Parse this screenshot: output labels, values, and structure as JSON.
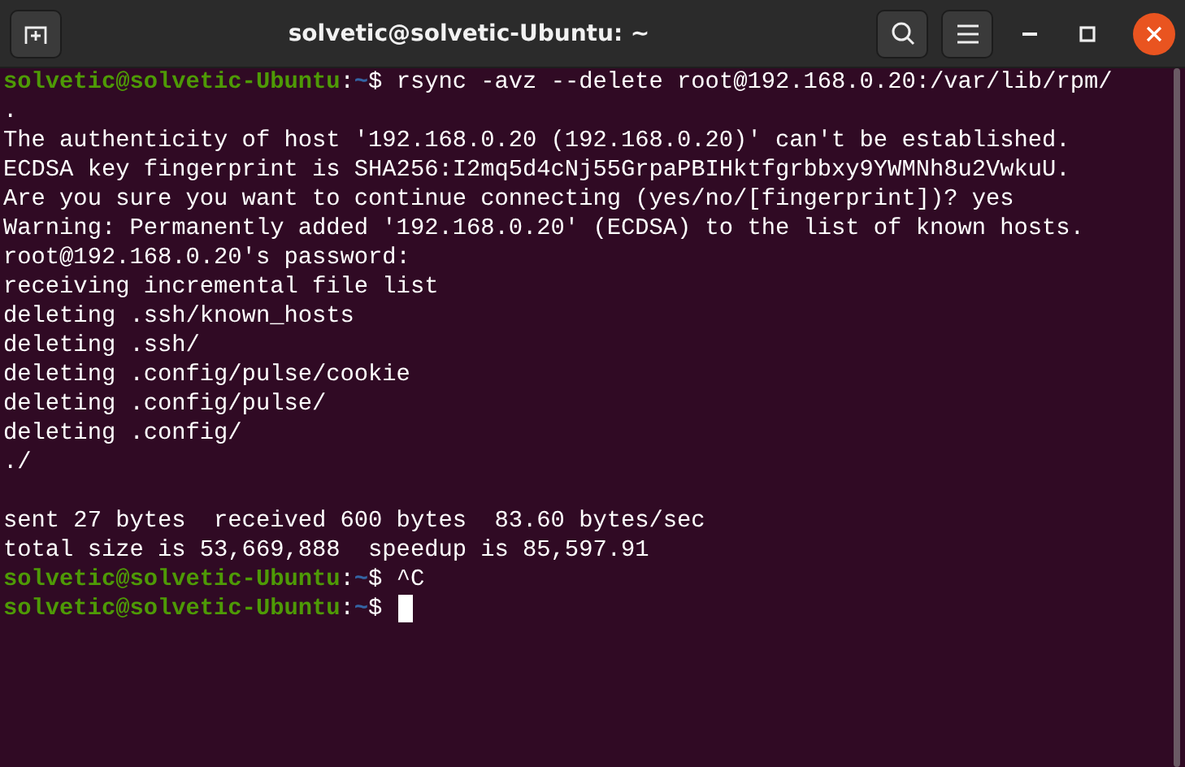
{
  "window": {
    "title": "solvetic@solvetic-Ubuntu: ~"
  },
  "lines": [
    {
      "kind": "prompt",
      "host": "solvetic@solvetic-Ubuntu",
      "sep": ":",
      "path": "~",
      "symbol": "$",
      "command": "rsync -avz --delete root@192.168.0.20:/var/lib/rpm/",
      "cursor": false
    },
    {
      "kind": "output",
      "text": "."
    },
    {
      "kind": "output",
      "text": "The authenticity of host '192.168.0.20 (192.168.0.20)' can't be established."
    },
    {
      "kind": "output",
      "text": "ECDSA key fingerprint is SHA256:I2mq5d4cNj55GrpaPBIHktfgrbbxy9YWMNh8u2VwkuU."
    },
    {
      "kind": "output",
      "text": "Are you sure you want to continue connecting (yes/no/[fingerprint])? yes"
    },
    {
      "kind": "output",
      "text": "Warning: Permanently added '192.168.0.20' (ECDSA) to the list of known hosts."
    },
    {
      "kind": "output",
      "text": "root@192.168.0.20's password:"
    },
    {
      "kind": "output",
      "text": "receiving incremental file list"
    },
    {
      "kind": "output",
      "text": "deleting .ssh/known_hosts"
    },
    {
      "kind": "output",
      "text": "deleting .ssh/"
    },
    {
      "kind": "output",
      "text": "deleting .config/pulse/cookie"
    },
    {
      "kind": "output",
      "text": "deleting .config/pulse/"
    },
    {
      "kind": "output",
      "text": "deleting .config/"
    },
    {
      "kind": "output",
      "text": "./"
    },
    {
      "kind": "blank"
    },
    {
      "kind": "output",
      "text": "sent 27 bytes  received 600 bytes  83.60 bytes/sec"
    },
    {
      "kind": "output",
      "text": "total size is 53,669,888  speedup is 85,597.91"
    },
    {
      "kind": "prompt",
      "host": "solvetic@solvetic-Ubuntu",
      "sep": ":",
      "path": "~",
      "symbol": "$",
      "command": "^C",
      "cursor": false
    },
    {
      "kind": "prompt",
      "host": "solvetic@solvetic-Ubuntu",
      "sep": ":",
      "path": "~",
      "symbol": "$",
      "cursor": true
    }
  ]
}
